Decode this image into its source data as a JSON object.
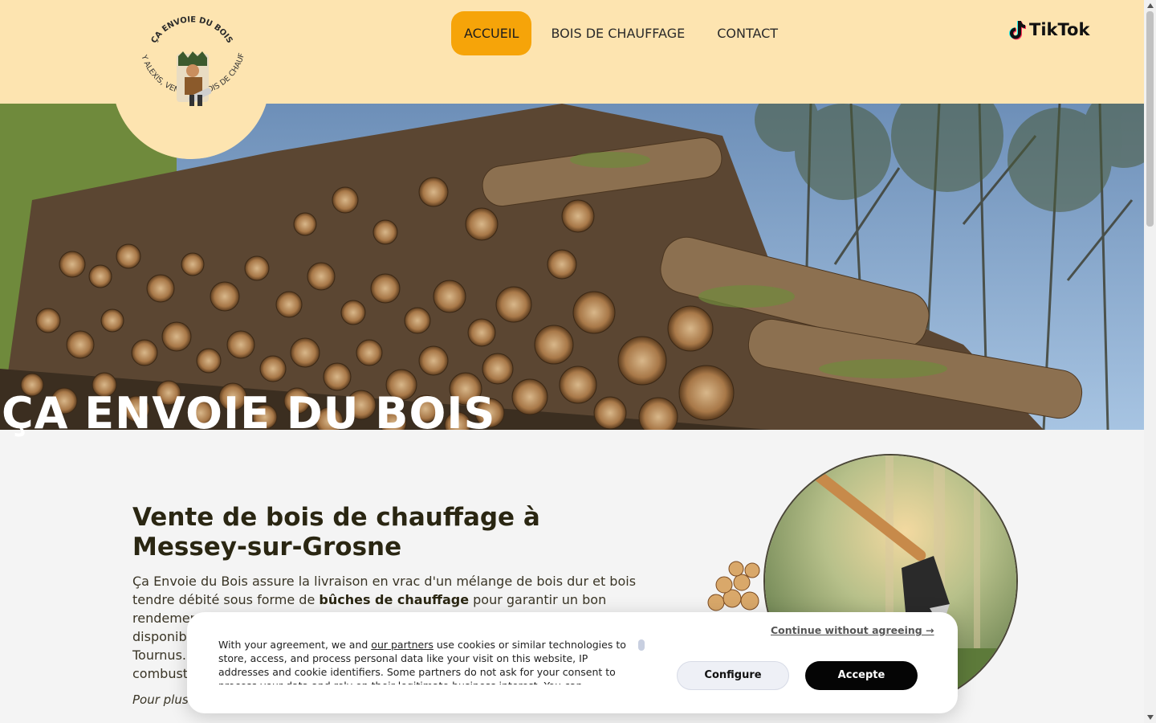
{
  "nav": {
    "items": [
      {
        "label": "ACCUEIL",
        "active": true
      },
      {
        "label": "BOIS DE CHAUFFAGE",
        "active": false
      },
      {
        "label": "CONTACT",
        "active": false
      }
    ]
  },
  "social": {
    "tiktok_label": "TikTok",
    "icon": "tiktok-icon"
  },
  "logo": {
    "top_text": "ÇA ENVOIE DU BOIS",
    "ring_text": "DUPUY ALEXIS, VENTE DE BOIS DE CHAUFFAGE"
  },
  "hero": {
    "title": "ÇA ENVOIE DU BOIS"
  },
  "content": {
    "title": "Vente de bois de chauffage à Messey-sur-Grosne",
    "paragraph_part1": "Ça Envoie du Bois assure la livraison en vrac d'un mélange de bois dur et bois tendre débité sous forme de ",
    "paragraph_bold": "bûches de chauffage",
    "paragraph_part2": " pour garantir un bon rendement",
    "paragraph_line3": "disponib",
    "paragraph_line4": "Tournus.",
    "paragraph_line5": "combust",
    "more": "Pour plus"
  },
  "cookie": {
    "text_before_link": "With your agreement, we and ",
    "link": "our partners",
    "text_after_link": " use cookies or similar technologies to store, access, and process personal data like your visit on this website, IP addresses and cookie identifiers. Some partners do not ask for your consent to process your data and rely on their legitimate business interest. You can",
    "continue": "Continue without agreeing →",
    "configure": "Configure",
    "accept": "Accepte"
  },
  "colors": {
    "header_bg": "#fde4b0",
    "accent": "#f6a409",
    "page_bg": "#f4f4f4"
  }
}
